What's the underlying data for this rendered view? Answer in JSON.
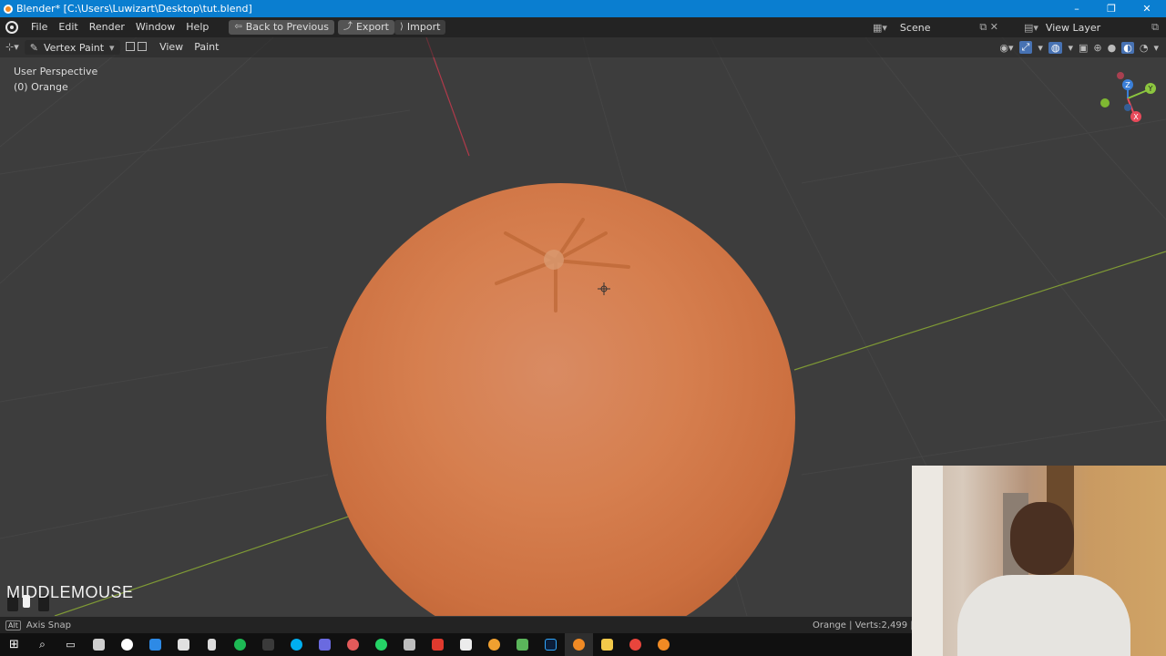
{
  "window": {
    "title": "Blender* [C:\\Users\\Luwizart\\Desktop\\tut.blend]",
    "minimize": "–",
    "restore": "❐",
    "close": "✕"
  },
  "menubar": {
    "items": [
      "File",
      "Edit",
      "Render",
      "Window",
      "Help"
    ],
    "back_to_previous": "Back to Previous",
    "export": "Export",
    "import": "Import",
    "scene": "Scene",
    "view_layer": "View Layer"
  },
  "viewport_header": {
    "mode": "Vertex Paint",
    "view": "View",
    "paint": "Paint"
  },
  "viewport": {
    "perspective": "User Perspective",
    "object": "(0) Orange",
    "key_hint": "MIDDLEMOUSE",
    "gizmo": {
      "x": "X",
      "y": "Y",
      "z": "Z"
    }
  },
  "statusbar": {
    "key": "Alt",
    "hint": "Axis Snap",
    "stats": "Orange | Verts:2,499 | Fac"
  },
  "colors": {
    "accent": "#0a7ed0",
    "orange": "#d67f4f",
    "axis_x": "#e84a5a",
    "axis_y": "#8cc63f",
    "axis_z": "#3a7fd8"
  },
  "taskbar": {
    "icons": [
      "windows-start-icon",
      "search-icon",
      "task-view-icon",
      "app-icon",
      "app-icon",
      "app-icon",
      "camera-icon",
      "calculator-icon",
      "spotify-icon",
      "app-icon",
      "skype-icon",
      "app-icon",
      "app-icon",
      "whatsapp-icon",
      "app-icon",
      "app-icon",
      "app-icon",
      "app-icon",
      "app-icon",
      "photoshop-icon",
      "blender-icon",
      "file-explorer-icon",
      "chrome-icon",
      "blender-icon"
    ]
  }
}
